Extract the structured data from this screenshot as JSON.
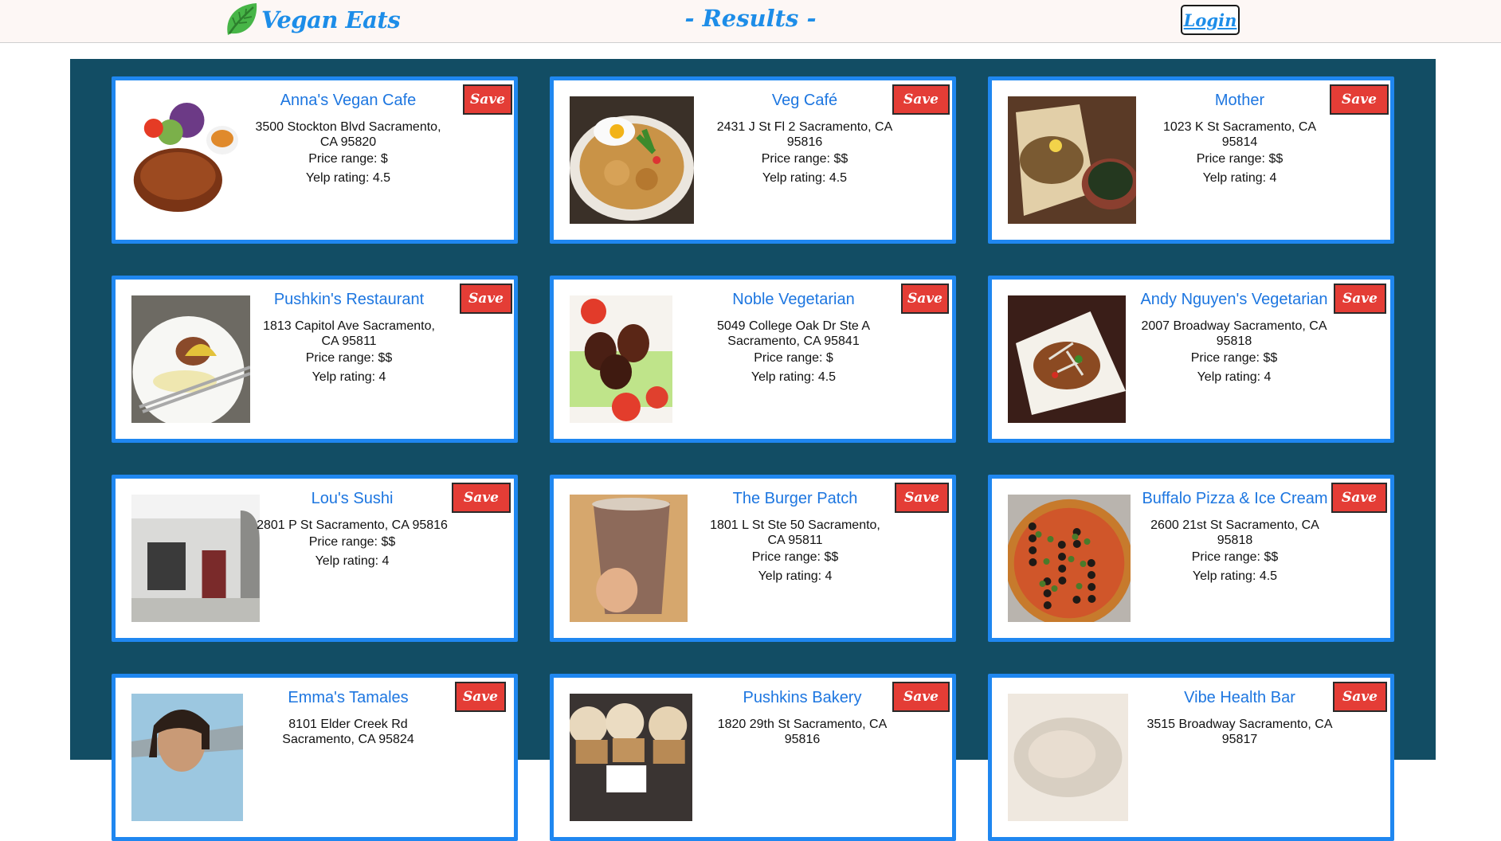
{
  "header": {
    "brand": "Vegan Eats",
    "page_title": "- Results -",
    "login_label": "Login"
  },
  "colors": {
    "accent_blue": "#1d8de8",
    "panel_bg": "#124d64",
    "card_border": "#1f87f0",
    "save_red": "#e43d36"
  },
  "restaurants": [
    {
      "name": "Anna's Vegan Cafe",
      "address": "3500 Stockton Blvd Sacramento, CA 95820",
      "price": "Price range: $",
      "rating": "Yelp rating: 4.5",
      "save_label": "Save",
      "photo": "steak-with-salad-icon"
    },
    {
      "name": "Veg Café",
      "address": "2431 J St Fl 2 Sacramento, CA 95816",
      "price": "Price range: $$",
      "rating": "Yelp rating: 4.5",
      "save_label": "Save",
      "photo": "potato-bowl-with-egg-icon"
    },
    {
      "name": "Mother",
      "address": "1023 K St Sacramento, CA 95814",
      "price": "Price range: $$",
      "rating": "Yelp rating: 4",
      "save_label": "Save",
      "photo": "grain-dish-with-greens-icon"
    },
    {
      "name": "Pushkin's Restaurant",
      "address": "1813 Capitol Ave Sacramento, CA 95811",
      "price": "Price range: $$",
      "rating": "Yelp rating: 4",
      "save_label": "Save",
      "photo": "plated-dish-with-fork-icon"
    },
    {
      "name": "Noble Vegetarian",
      "address": "5049 College Oak Dr Ste A Sacramento, CA 95841",
      "price": "Price range: $",
      "rating": "Yelp rating: 4.5",
      "save_label": "Save",
      "photo": "fried-balls-on-lettuce-icon"
    },
    {
      "name": "Andy Nguyen's Vegetarian",
      "address": "2007 Broadway Sacramento, CA 95818",
      "price": "Price range: $$",
      "rating": "Yelp rating: 4",
      "save_label": "Save",
      "photo": "stir-fry-plate-icon"
    },
    {
      "name": "Lou's Sushi",
      "address": "2801 P St Sacramento, CA 95816",
      "price": "Price range: $$",
      "rating": "Yelp rating: 4",
      "save_label": "Save",
      "photo": "storefront-icon"
    },
    {
      "name": "The Burger Patch",
      "address": "1801 L St Ste 50 Sacramento, CA 95811",
      "price": "Price range: $$",
      "rating": "Yelp rating: 4",
      "save_label": "Save",
      "photo": "chocolate-shake-icon"
    },
    {
      "name": "Buffalo Pizza & Ice Cream",
      "address": "2600 21st St Sacramento, CA 95818",
      "price": "Price range: $$",
      "rating": "Yelp rating: 4.5",
      "save_label": "Save",
      "photo": "pizza-icon"
    },
    {
      "name": "Emma's Tamales",
      "address": "8101 Elder Creek Rd Sacramento, CA 95824",
      "price": "",
      "rating": "",
      "save_label": "Save",
      "photo": "person-portrait-icon"
    },
    {
      "name": "Pushkins Bakery",
      "address": "1820 29th St Sacramento, CA 95816",
      "price": "",
      "rating": "",
      "save_label": "Save",
      "photo": "cupcakes-icon"
    },
    {
      "name": "Vibe Health Bar",
      "address": "3515 Broadway Sacramento, CA 95817",
      "price": "",
      "rating": "",
      "save_label": "Save",
      "photo": "bowl-icon"
    }
  ]
}
